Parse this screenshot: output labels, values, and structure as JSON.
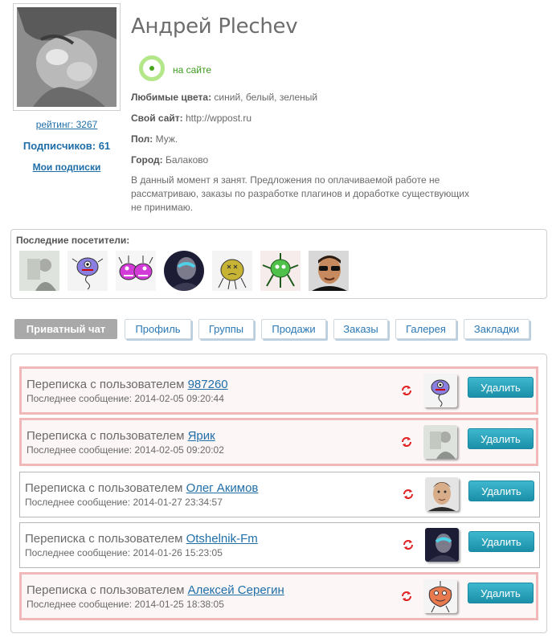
{
  "profile": {
    "name": "Андрей Plechev",
    "online_label": "на сайте",
    "rating": "рейтинг: 3267",
    "subscribers": "Подписчиков: 61",
    "my_subscriptions": "Мои подписки",
    "fields": [
      {
        "label": "Любимые цвета:",
        "value": " синий, белый, зеленый"
      },
      {
        "label": "Свой сайт:",
        "value": " http://wppost.ru"
      },
      {
        "label": "Пол:",
        "value": " Муж."
      },
      {
        "label": "Город:",
        "value": " Балаково"
      }
    ],
    "status": "В данный момент я занят. Предложения по оплачиваемой работе не рассматриваю, заказы по разработке плагинов и доработке существующих не принимаю.",
    "colors": {
      "online": "#3c9a1d",
      "link": "#1f6ea8"
    }
  },
  "visitors": {
    "title": "Последние посетители:"
  },
  "tabs": [
    {
      "label": "Приватный чат",
      "active": true
    },
    {
      "label": "Профиль"
    },
    {
      "label": "Группы"
    },
    {
      "label": "Продажи"
    },
    {
      "label": "Заказы"
    },
    {
      "label": "Галерея"
    },
    {
      "label": "Закладки"
    }
  ],
  "chats": [
    {
      "prefix": "Переписка с пользователем ",
      "user": "987260",
      "date": "Последнее сообщение: 2014-02-05 09:20:44",
      "unread": true
    },
    {
      "prefix": "Переписка с пользователем ",
      "user": "Ярик",
      "date": "Последнее сообщение: 2014-02-05 09:20:02",
      "unread": true
    },
    {
      "prefix": "Переписка с пользователем ",
      "user": "Олег Акимов",
      "date": "Последнее сообщение: 2014-01-27 23:34:57",
      "unread": false
    },
    {
      "prefix": "Переписка с пользователем ",
      "user": "Otshelnik-Fm",
      "date": "Последнее сообщение: 2014-01-26 15:23:05",
      "unread": false
    },
    {
      "prefix": "Переписка с пользователем ",
      "user": "Алексей Серегин",
      "date": "Последнее сообщение: 2014-01-25 18:38:05",
      "unread": true
    }
  ],
  "chat_actions": {
    "delete_label": "Удалить",
    "refresh_icon": "refresh-icon"
  }
}
